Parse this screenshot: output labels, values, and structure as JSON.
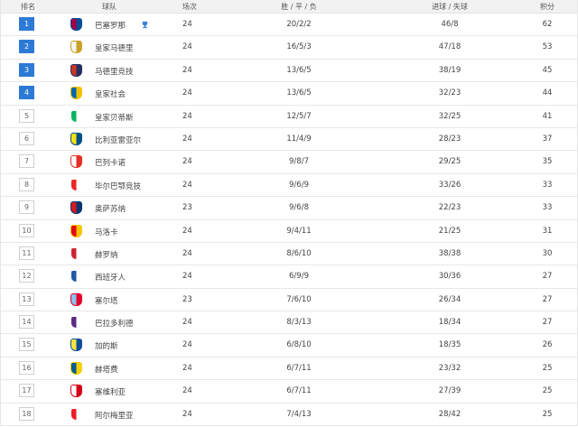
{
  "header": {
    "rank": "排名",
    "team": "球队",
    "played": "场次",
    "wdl": "胜 / 平 / 负",
    "goals": "进球 / 失球",
    "points": "积分"
  },
  "colors": {
    "top_rank": "#2d7ad6",
    "header_bg": "#f2f2f2",
    "trophy": "#3a7fd5"
  },
  "rows": [
    {
      "rank": "1",
      "team": "巴塞罗那",
      "played": "24",
      "wdl": "20/2/2",
      "goals": "46/8",
      "points": "62",
      "top": true,
      "crest": "fc-barcelona-crest",
      "c1": "#a50044",
      "c2": "#004d98",
      "trophy": true
    },
    {
      "rank": "2",
      "team": "皇家马德里",
      "played": "24",
      "wdl": "16/5/3",
      "goals": "47/18",
      "points": "53",
      "top": true,
      "crest": "real-madrid-crest",
      "c1": "#f4f4f4",
      "c2": "#c9a227"
    },
    {
      "rank": "3",
      "team": "马德里竞技",
      "played": "24",
      "wdl": "13/6/5",
      "goals": "38/19",
      "points": "45",
      "top": true,
      "crest": "atletico-madrid-crest",
      "c1": "#cb3524",
      "c2": "#272e61"
    },
    {
      "rank": "4",
      "team": "皇家社会",
      "played": "24",
      "wdl": "13/6/5",
      "goals": "32/23",
      "points": "44",
      "top": true,
      "crest": "real-sociedad-crest",
      "c1": "#0067b1",
      "c2": "#f2c200"
    },
    {
      "rank": "5",
      "team": "皇家贝蒂斯",
      "played": "24",
      "wdl": "12/5/7",
      "goals": "32/25",
      "points": "41",
      "top": false,
      "crest": "real-betis-crest",
      "c1": "#0bb363",
      "c2": "#ffffff"
    },
    {
      "rank": "6",
      "team": "比利亚雷亚尔",
      "played": "24",
      "wdl": "11/4/9",
      "goals": "28/23",
      "points": "37",
      "top": false,
      "crest": "villarreal-crest",
      "c1": "#ffe114",
      "c2": "#005187"
    },
    {
      "rank": "7",
      "team": "巴列卡诺",
      "played": "24",
      "wdl": "9/8/7",
      "goals": "29/25",
      "points": "35",
      "top": false,
      "crest": "rayo-vallecano-crest",
      "c1": "#ffffff",
      "c2": "#e53027"
    },
    {
      "rank": "8",
      "team": "毕尔巴鄂竞技",
      "played": "24",
      "wdl": "9/6/9",
      "goals": "33/26",
      "points": "33",
      "top": false,
      "crest": "athletic-bilbao-crest",
      "c1": "#ee2523",
      "c2": "#ffffff"
    },
    {
      "rank": "9",
      "team": "奥萨苏纳",
      "played": "23",
      "wdl": "9/6/8",
      "goals": "22/23",
      "points": "33",
      "top": false,
      "crest": "osasuna-crest",
      "c1": "#d91a21",
      "c2": "#0a346f"
    },
    {
      "rank": "10",
      "team": "马洛卡",
      "played": "24",
      "wdl": "9/4/11",
      "goals": "21/25",
      "points": "31",
      "top": false,
      "crest": "mallorca-crest",
      "c1": "#e20613",
      "c2": "#f7c600"
    },
    {
      "rank": "11",
      "team": "赫罗纳",
      "played": "24",
      "wdl": "8/6/10",
      "goals": "38/38",
      "points": "30",
      "top": false,
      "crest": "girona-crest",
      "c1": "#cd2534",
      "c2": "#ffffff"
    },
    {
      "rank": "12",
      "team": "西班牙人",
      "played": "24",
      "wdl": "6/9/9",
      "goals": "30/36",
      "points": "27",
      "top": false,
      "crest": "espanyol-crest",
      "c1": "#1e5aa8",
      "c2": "#ffffff"
    },
    {
      "rank": "13",
      "team": "塞尔塔",
      "played": "23",
      "wdl": "7/6/10",
      "goals": "26/34",
      "points": "27",
      "top": false,
      "crest": "celta-vigo-crest",
      "c1": "#8ac3ee",
      "c2": "#e4002b"
    },
    {
      "rank": "14",
      "team": "巴拉多利德",
      "played": "24",
      "wdl": "8/3/13",
      "goals": "18/34",
      "points": "27",
      "top": false,
      "crest": "valladolid-crest",
      "c1": "#5d2a85",
      "c2": "#ffffff"
    },
    {
      "rank": "15",
      "team": "加的斯",
      "played": "24",
      "wdl": "6/8/10",
      "goals": "18/35",
      "points": "26",
      "top": false,
      "crest": "cadiz-crest",
      "c1": "#f9e53b",
      "c2": "#0f4d9b"
    },
    {
      "rank": "16",
      "team": "赫塔费",
      "played": "24",
      "wdl": "6/7/11",
      "goals": "23/32",
      "points": "25",
      "top": false,
      "crest": "getafe-crest",
      "c1": "#005999",
      "c2": "#f4d000"
    },
    {
      "rank": "17",
      "team": "塞维利亚",
      "played": "24",
      "wdl": "6/7/11",
      "goals": "27/39",
      "points": "25",
      "top": false,
      "crest": "sevilla-crest",
      "c1": "#ffffff",
      "c2": "#d4001a"
    },
    {
      "rank": "18",
      "team": "阿尔梅里亚",
      "played": "24",
      "wdl": "7/4/13",
      "goals": "28/42",
      "points": "25",
      "top": false,
      "crest": "almeria-crest",
      "c1": "#ee1c25",
      "c2": "#ffffff"
    }
  ]
}
